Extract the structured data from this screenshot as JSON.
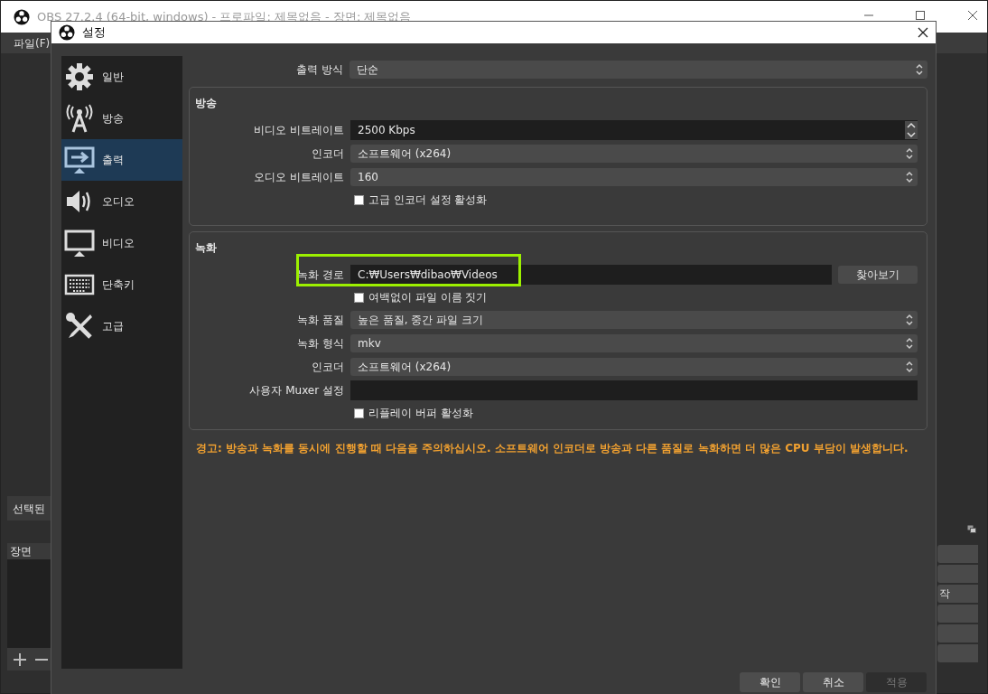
{
  "main_window": {
    "title": "OBS 27.2.4 (64-bit, windows) - 프로파일: 제목없음 - 장면: 제목없음",
    "menu": [
      "파일(F)"
    ],
    "selected_dock_title": "선택된",
    "scenes_dock": {
      "title": "장면"
    },
    "control_buttons": [
      {
        "kind": "blank"
      },
      {
        "kind": "blank"
      },
      {
        "kind": "labeled",
        "text": "작"
      },
      {
        "kind": "blank"
      },
      {
        "kind": "blank"
      },
      {
        "kind": "blank"
      }
    ]
  },
  "dialog": {
    "title": "설정",
    "sidebar": [
      {
        "label": "일반",
        "selected": false
      },
      {
        "label": "방송",
        "selected": false
      },
      {
        "label": "출력",
        "selected": true
      },
      {
        "label": "오디오",
        "selected": false
      },
      {
        "label": "비디오",
        "selected": false
      },
      {
        "label": "단축키",
        "selected": false
      },
      {
        "label": "고급",
        "selected": false
      }
    ],
    "output_mode": {
      "label": "출력 방식",
      "value": "단순"
    },
    "groups": [
      {
        "title": "방송",
        "rows": [
          {
            "kind": "spin",
            "label": "비디오 비트레이트",
            "value": "2500 Kbps"
          },
          {
            "kind": "combo",
            "label": "인코더",
            "value": "소프트웨어 (x264)"
          },
          {
            "kind": "combo",
            "label": "오디오 비트레이트",
            "value": "160"
          },
          {
            "kind": "checkbox",
            "label": "고급 인코더 설정 활성화",
            "checked": false
          }
        ]
      },
      {
        "title": "녹화",
        "rows": [
          {
            "kind": "path",
            "label": "녹화 경로",
            "value": "C:₩Users₩dibao₩Videos",
            "button": "찾아보기",
            "highlighted": true
          },
          {
            "kind": "checkbox",
            "label": "여백없이 파일 이름 짓기",
            "checked": false
          },
          {
            "kind": "combo",
            "label": "녹화 품질",
            "value": "높은 품질, 중간 파일 크기"
          },
          {
            "kind": "combo",
            "label": "녹화 형식",
            "value": "mkv"
          },
          {
            "kind": "combo",
            "label": "인코더",
            "value": "소프트웨어 (x264)"
          },
          {
            "kind": "text",
            "label": "사용자 Muxer 설정",
            "value": ""
          },
          {
            "kind": "checkbox",
            "label": "리플레이 버퍼 활성화",
            "checked": false
          }
        ]
      }
    ],
    "warning": "경고: 방송과 녹화를 동시에 진행할 때 다음을 주의하십시오. 소프트웨어 인코더로 방송과 다른 품질로 녹화하면 더 많은 CPU 부담이 발생합니다.",
    "buttons": [
      {
        "label": "확인",
        "disabled": false
      },
      {
        "label": "취소",
        "disabled": false
      },
      {
        "label": "적용",
        "disabled": true
      }
    ]
  }
}
